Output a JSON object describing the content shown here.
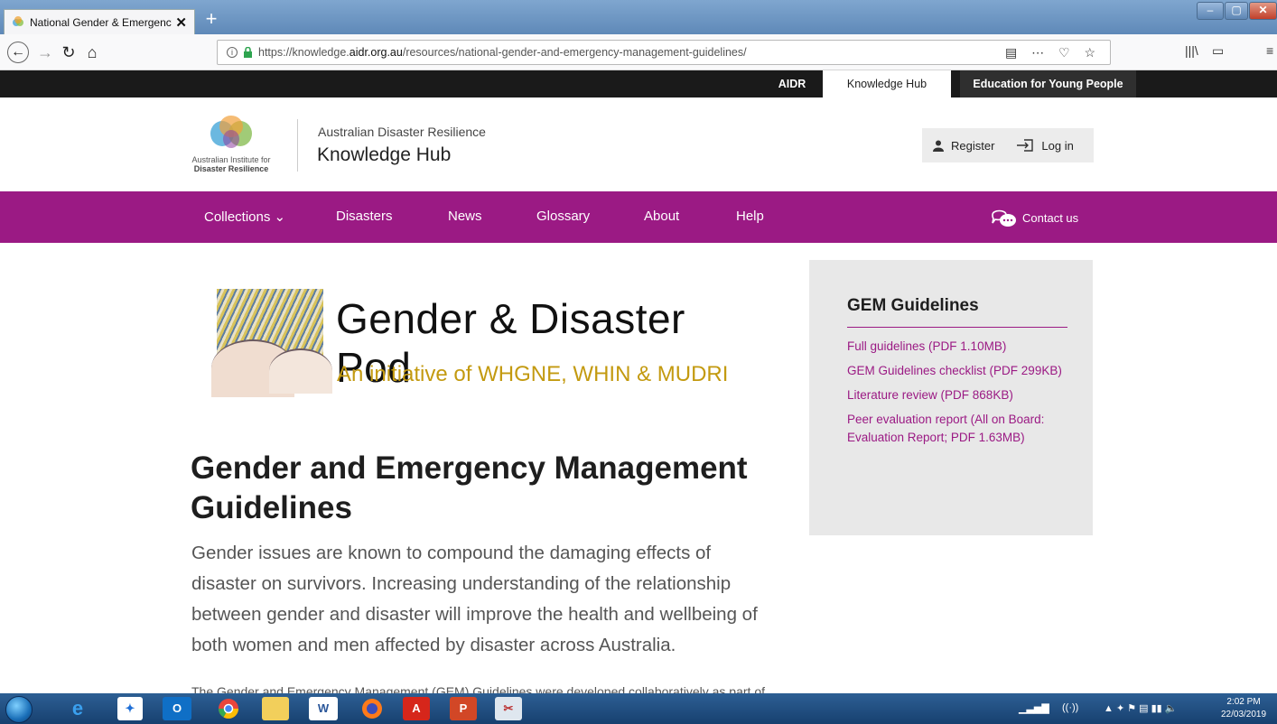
{
  "browser": {
    "tab_title": "National Gender & Emergency",
    "tab_close": "✕",
    "new_tab": "+",
    "url_prefix": "https://knowledge.",
    "url_host": "aidr.org.au",
    "url_path": "/resources/national-gender-and-emergency-management-guidelines/",
    "window_controls": {
      "minimize": "–",
      "maximize": "▢",
      "close": "✕"
    }
  },
  "top_strip": {
    "items": [
      "AIDR",
      "Knowledge Hub",
      "Education for Young People"
    ]
  },
  "header": {
    "logo_line1": "Australian Institute for",
    "logo_line2": "Disaster Resilience",
    "subtitle": "Australian Disaster Resilience",
    "title": "Knowledge Hub",
    "register": "Register",
    "login": "Log in"
  },
  "nav": {
    "collections": "Collections ⌄",
    "disasters": "Disasters",
    "news": "News",
    "glossary": "Glossary",
    "about": "About",
    "help": "Help",
    "contact": "Contact us"
  },
  "banner": {
    "title": "Gender & Disaster Pod",
    "tagline": "An initiative of WHGNE, WHIN & MUDRI"
  },
  "article": {
    "heading": "Gender and Emergency Management Guidelines",
    "lead": "Gender issues are known to compound the damaging effects of disaster on survivors. Increasing understanding of the relationship between gender and disaster will improve the health and wellbeing of both women and men affected by disaster across Australia.",
    "body_cut": "The Gender and Emergency Management (GEM) Guidelines were developed collaboratively as part of"
  },
  "sidebar": {
    "title": "GEM Guidelines",
    "links": [
      "Full guidelines (PDF 1.10MB)",
      "GEM Guidelines checklist (PDF 299KB)",
      "Literature review (PDF 868KB)",
      "Peer evaluation report (All on Board: Evaluation Report; PDF 1.63MB)"
    ]
  },
  "taskbar": {
    "clock_time": "2:02 PM",
    "clock_date": "22/03/2019"
  },
  "colors": {
    "purple": "#9b1a84",
    "strip": "#1a1a1a",
    "gold": "#c39a10"
  }
}
